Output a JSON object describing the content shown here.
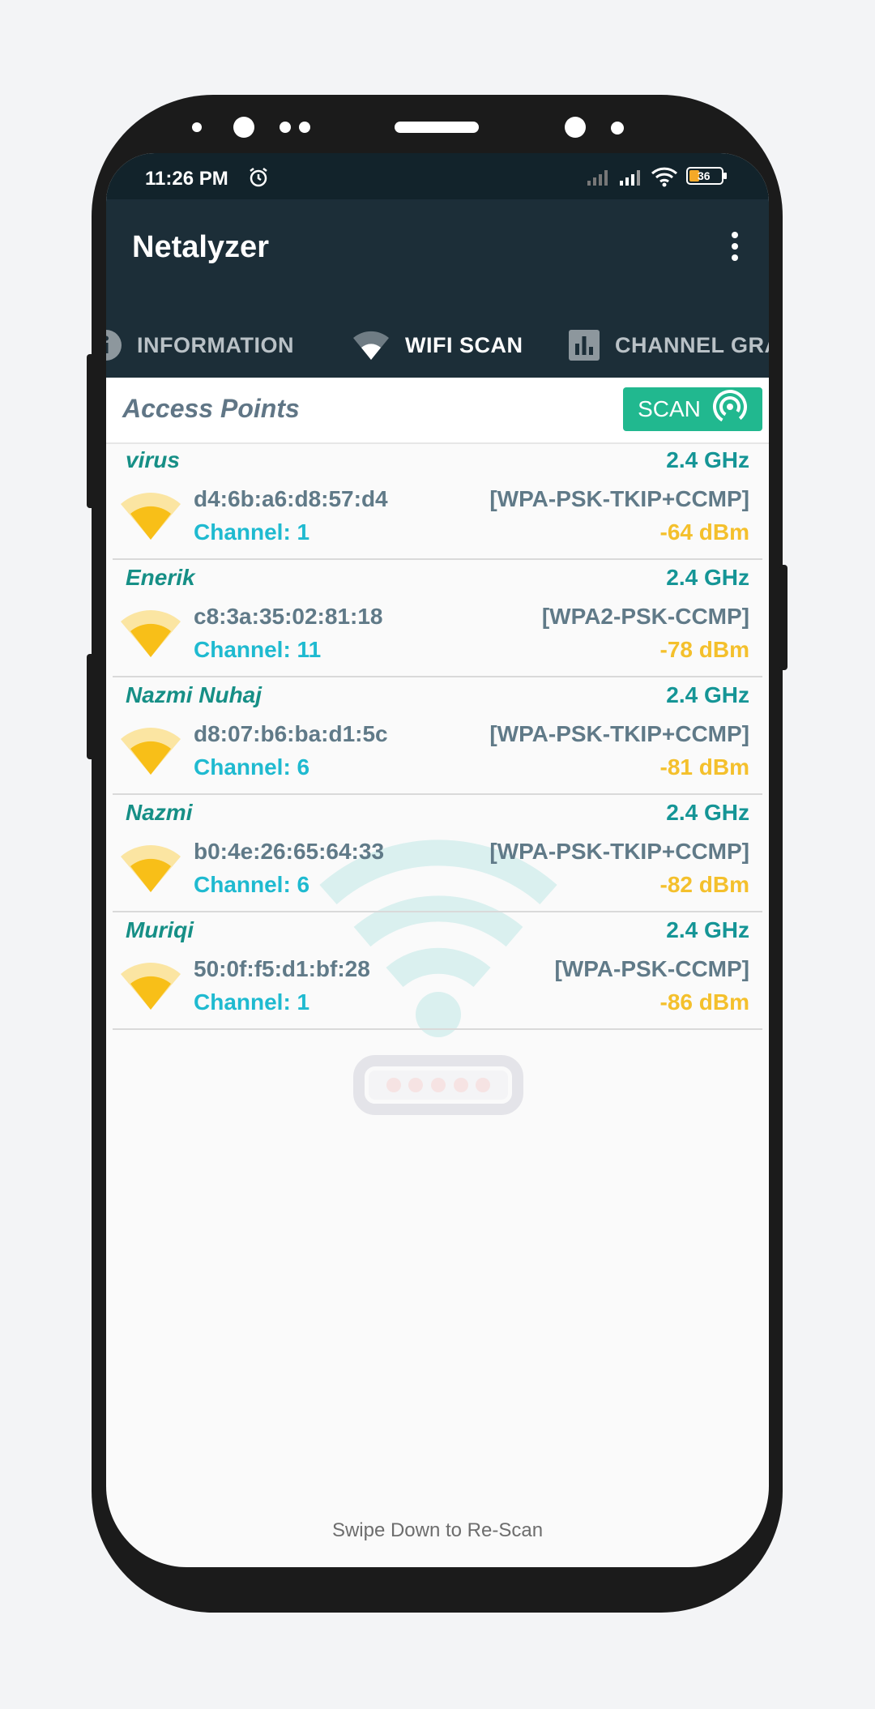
{
  "status": {
    "time": "11:26 PM",
    "battery": "36"
  },
  "app": {
    "title": "Netalyzer"
  },
  "tabs": [
    {
      "label": "INFORMATION",
      "icon": "info-icon"
    },
    {
      "label": "WIFI SCAN",
      "icon": "wifi-icon",
      "active": true
    },
    {
      "label": "CHANNEL GRA",
      "icon": "bar-chart-icon"
    }
  ],
  "access_points": {
    "title": "Access Points",
    "scan_label": "SCAN",
    "items": [
      {
        "ssid": "virus",
        "frequency": "2.4 GHz",
        "mac": "d4:6b:a6:d8:57:d4",
        "security": "[WPA-PSK-TKIP+CCMP]",
        "channel": "Channel: 1",
        "signal": "-64 dBm"
      },
      {
        "ssid": "Enerik",
        "frequency": "2.4 GHz",
        "mac": "c8:3a:35:02:81:18",
        "security": "[WPA2-PSK-CCMP]",
        "channel": "Channel: 11",
        "signal": "-78 dBm"
      },
      {
        "ssid": "Nazmi Nuhaj",
        "frequency": "2.4 GHz",
        "mac": "d8:07:b6:ba:d1:5c",
        "security": "[WPA-PSK-TKIP+CCMP]",
        "channel": "Channel: 6",
        "signal": "-81 dBm"
      },
      {
        "ssid": "Nazmi",
        "frequency": "2.4 GHz",
        "mac": "b0:4e:26:65:64:33",
        "security": "[WPA-PSK-TKIP+CCMP]",
        "channel": "Channel: 6",
        "signal": "-82 dBm"
      },
      {
        "ssid": "Muriqi",
        "frequency": "2.4 GHz",
        "mac": "50:0f:f5:d1:bf:28",
        "security": "[WPA-PSK-CCMP]",
        "channel": "Channel: 1",
        "signal": "-86 dBm"
      }
    ]
  },
  "footer": {
    "hint": "Swipe Down to Re-Scan"
  },
  "colors": {
    "accent": "#21b88f",
    "tab_indicator": "#f6c22c",
    "appbar": "#1c2e38",
    "ssid": "#168f86",
    "channel": "#1fbad0",
    "signal": "#f4c02c"
  }
}
